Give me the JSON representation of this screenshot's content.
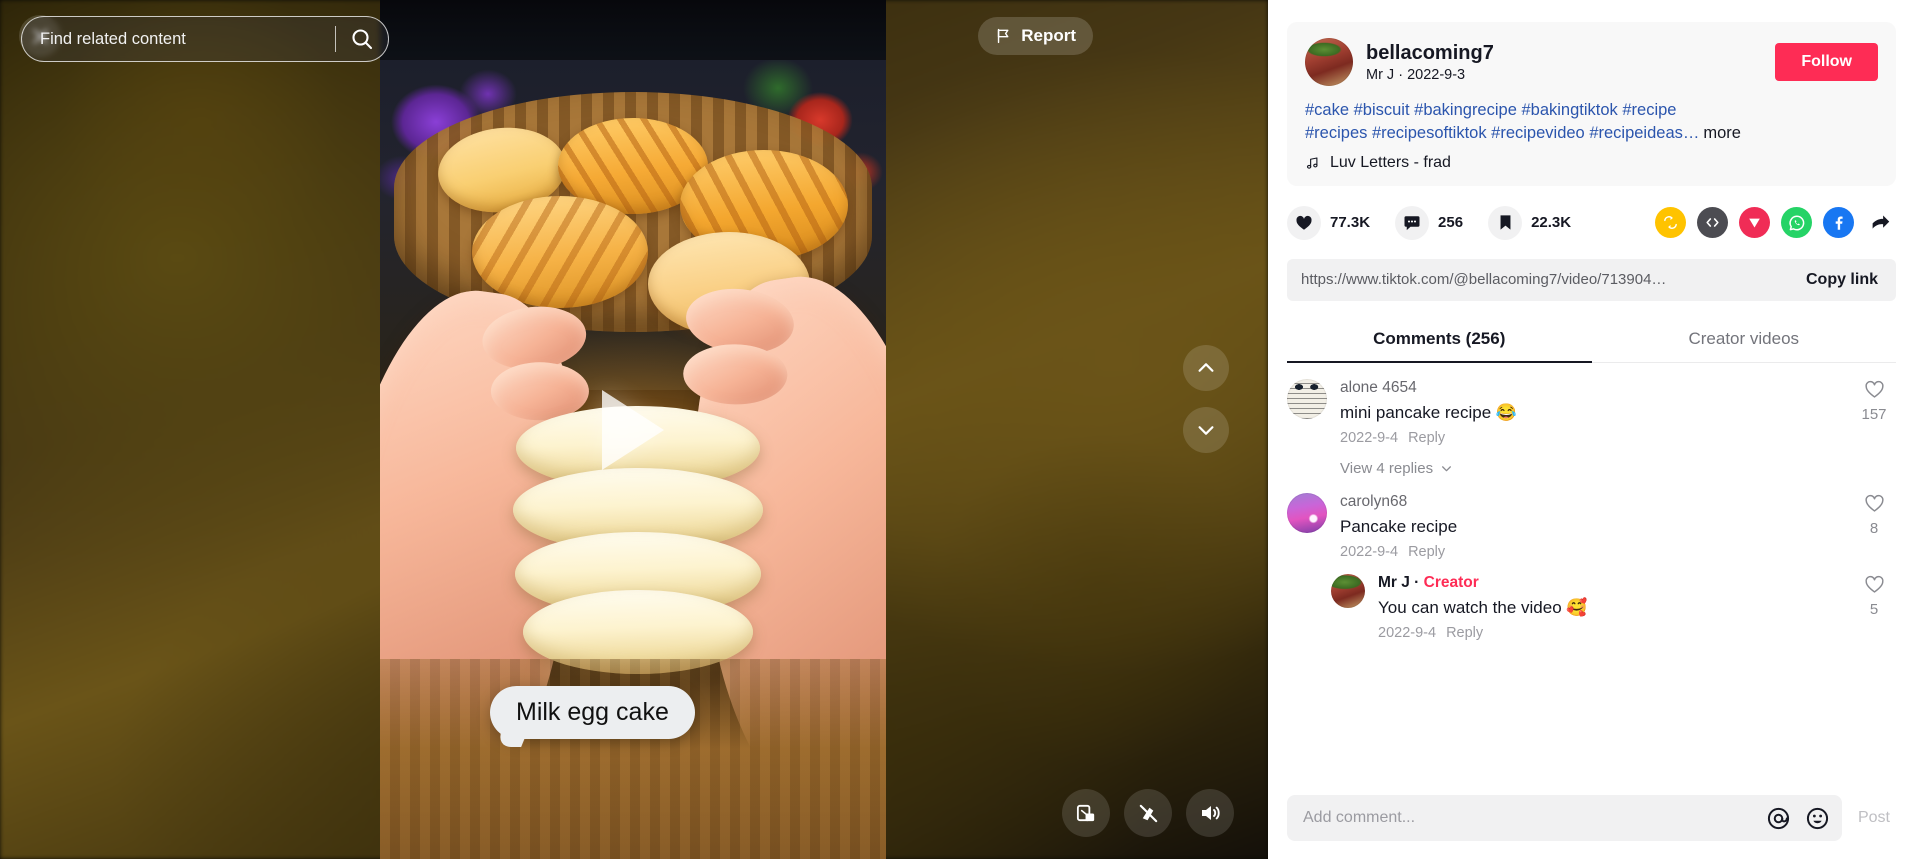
{
  "video": {
    "search_placeholder": "Find related content",
    "search_value": "",
    "search_icon": "search-icon",
    "close_icon": "close-icon",
    "report_label": "Report",
    "report_icon": "flag-icon",
    "caption_bubble": "Milk egg cake",
    "play_icon": "play-icon",
    "nav_up_icon": "chevron-up-icon",
    "nav_down_icon": "chevron-down-icon",
    "controls": [
      {
        "name": "picture-in-picture-button",
        "icon": "pip-icon"
      },
      {
        "name": "clear-display-button",
        "icon": "clear-mode-icon"
      },
      {
        "name": "volume-button",
        "icon": "volume-on-icon"
      }
    ]
  },
  "panel": {
    "author": {
      "username": "bellacoming7",
      "subtitle": "Mr J · 2022-9-3",
      "avatar": "steak-avatar",
      "follow_label": "Follow"
    },
    "description": {
      "line1": "#cake #biscuit #bakingrecipe #bakingtiktok #recipe",
      "line2": "#recipes #recipesoftiktok #recipevideo #recipeideas…",
      "more_label": "more"
    },
    "music": {
      "icon": "music-note-icon",
      "label": "Luv Letters - frad"
    },
    "stats": [
      {
        "name": "like-count",
        "icon": "heart-filled-icon",
        "value": "77.3K"
      },
      {
        "name": "comment-count",
        "icon": "comment-filled-icon",
        "value": "256"
      },
      {
        "name": "bookmark-count",
        "icon": "bookmark-filled-icon",
        "value": "22.3K"
      }
    ],
    "share_icons": [
      {
        "name": "repost-icon",
        "color": "#FFC300",
        "glyph": "repost"
      },
      {
        "name": "embed-code-icon",
        "color": "#4C4C52",
        "glyph": "code"
      },
      {
        "name": "telegram-icon",
        "color": "#F02C56",
        "glyph": "send"
      },
      {
        "name": "whatsapp-icon",
        "color": "#25D366",
        "glyph": "whatsapp"
      },
      {
        "name": "facebook-icon",
        "color": "#1877F2",
        "glyph": "facebook"
      },
      {
        "name": "share-arrow-icon",
        "color": "#161823",
        "glyph": "arrow"
      }
    ],
    "link": {
      "url": "https://www.tiktok.com/@bellacoming7/video/713904…",
      "copy_label": "Copy link"
    },
    "tabs": [
      {
        "label": "Comments (256)",
        "active": true
      },
      {
        "label": "Creator videos",
        "active": false
      }
    ],
    "comments": [
      {
        "avatar": "face-avatar",
        "name": "alone 4654",
        "text": "mini pancake recipe 😂",
        "date": "2022-9-4",
        "reply_label": "Reply",
        "like_icon": "heart-outline-icon",
        "likes": "157",
        "view_replies_label": "View 4 replies",
        "view_replies_icon": "chevron-down-icon"
      },
      {
        "avatar": "sunset-avatar",
        "name": "carolyn68",
        "text": "Pancake recipe",
        "date": "2022-9-4",
        "reply_label": "Reply",
        "like_icon": "heart-outline-icon",
        "likes": "8"
      }
    ],
    "reply": {
      "avatar": "steak-avatar",
      "name": "Mr J",
      "separator": " · ",
      "creator_badge": "Creator",
      "text": "You can watch the video 🥰",
      "date": "2022-9-4",
      "reply_label": "Reply",
      "like_icon": "heart-outline-icon",
      "likes": "5"
    },
    "comment_input": {
      "placeholder": "Add comment...",
      "value": "",
      "mention_icon": "at-mention-icon",
      "emoji_icon": "emoji-icon",
      "post_label": "Post"
    }
  },
  "colors": {
    "brand_red": "#FE2C55",
    "tag_blue": "#2B55AD",
    "text_primary": "#161823"
  }
}
